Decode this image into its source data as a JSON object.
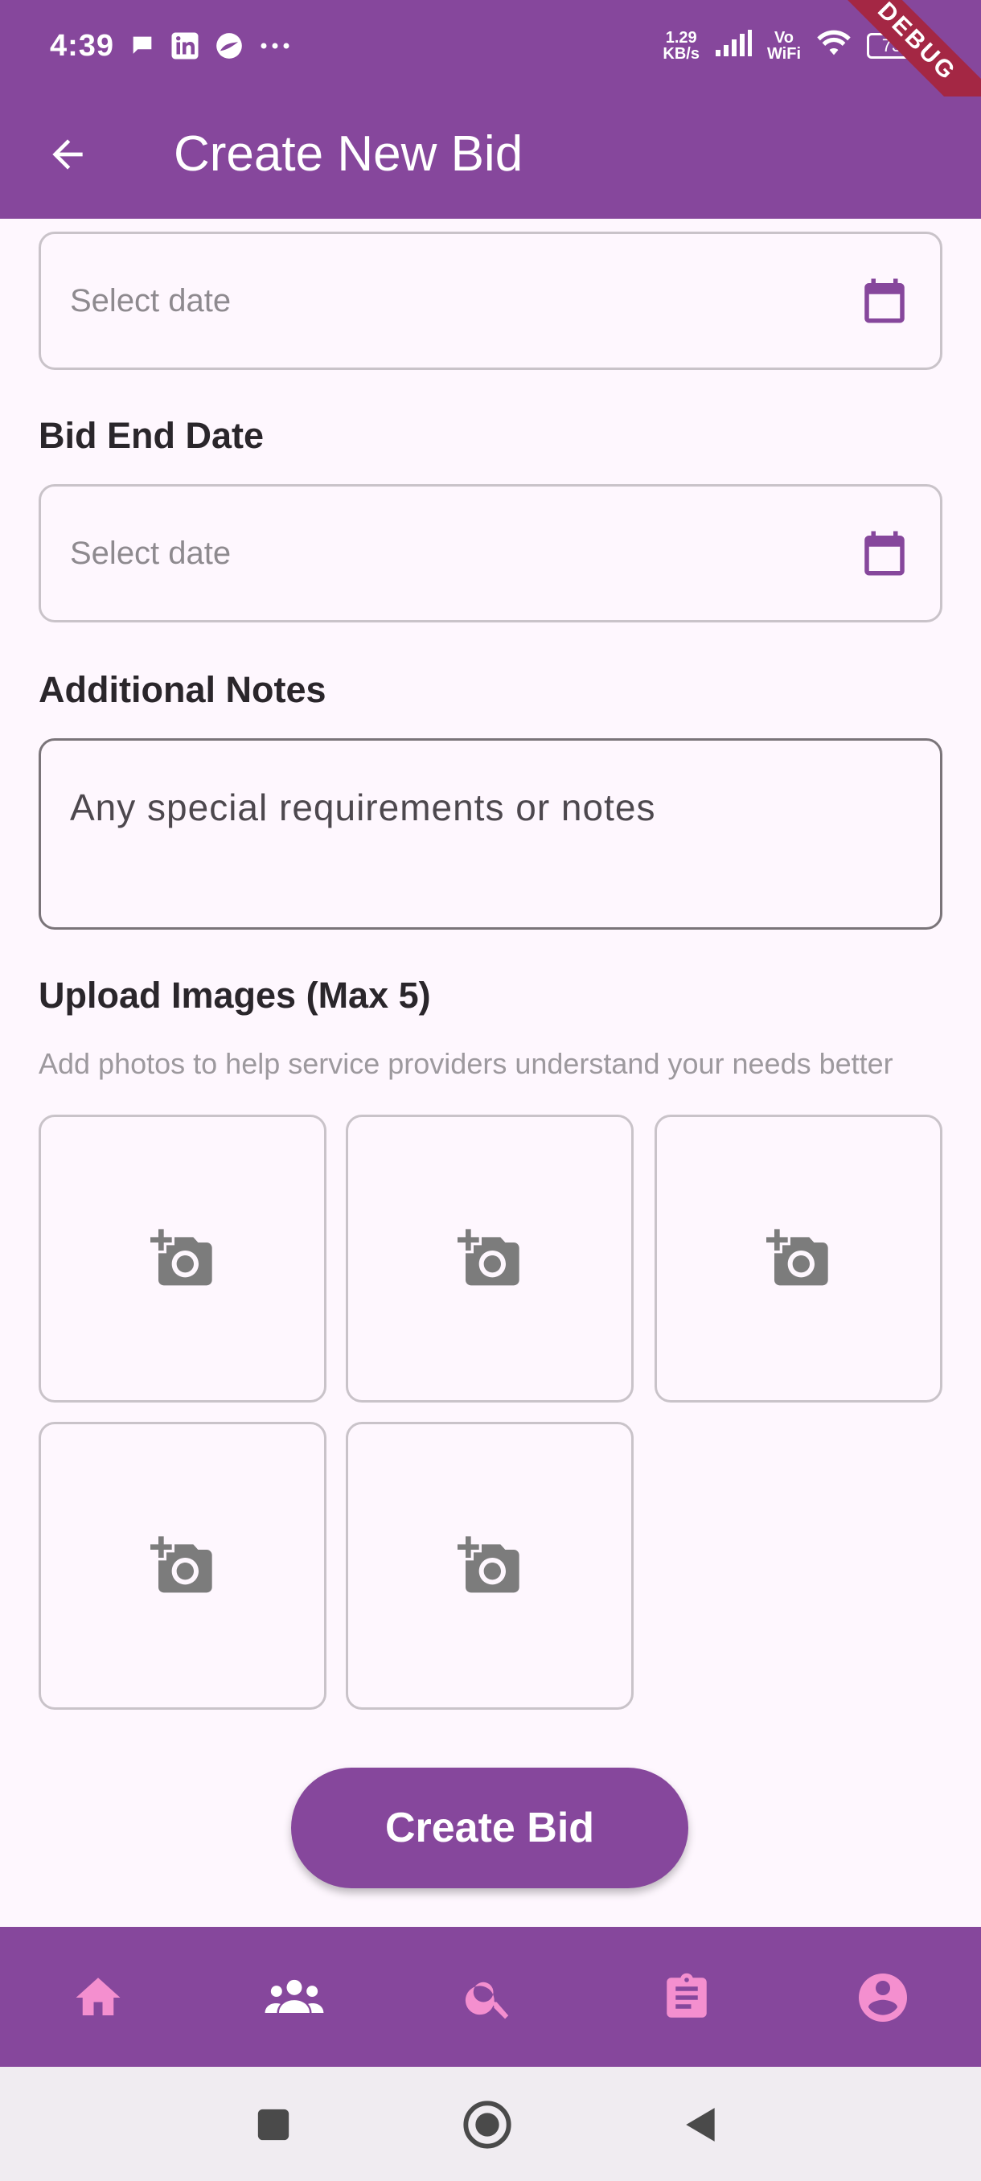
{
  "status_bar": {
    "time": "4:39",
    "net_speed_value": "1.29",
    "net_speed_unit": "KB/s",
    "vo": "Vo",
    "wifi": "WiFi",
    "battery": "73",
    "debug": "DEBUG"
  },
  "app_bar": {
    "title": "Create New Bid"
  },
  "form": {
    "start_date_placeholder": "Select date",
    "end_date_label": "Bid End Date",
    "end_date_placeholder": "Select date",
    "notes_label": "Additional Notes",
    "notes_placeholder": "Any special requirements or notes",
    "upload_label": "Upload Images (Max 5)",
    "upload_hint": "Add photos to help service providers understand your needs better",
    "image_slot_count": 5
  },
  "actions": {
    "create_label": "Create Bid"
  },
  "bottom_nav": {
    "items": [
      "home-icon",
      "people-icon",
      "search-icon",
      "assignment-icon",
      "account-icon"
    ],
    "icon_color": "#f48fcf"
  },
  "colors": {
    "primary": "#86479c",
    "background": "#fef7fe",
    "accent_pink": "#f48fcf"
  }
}
